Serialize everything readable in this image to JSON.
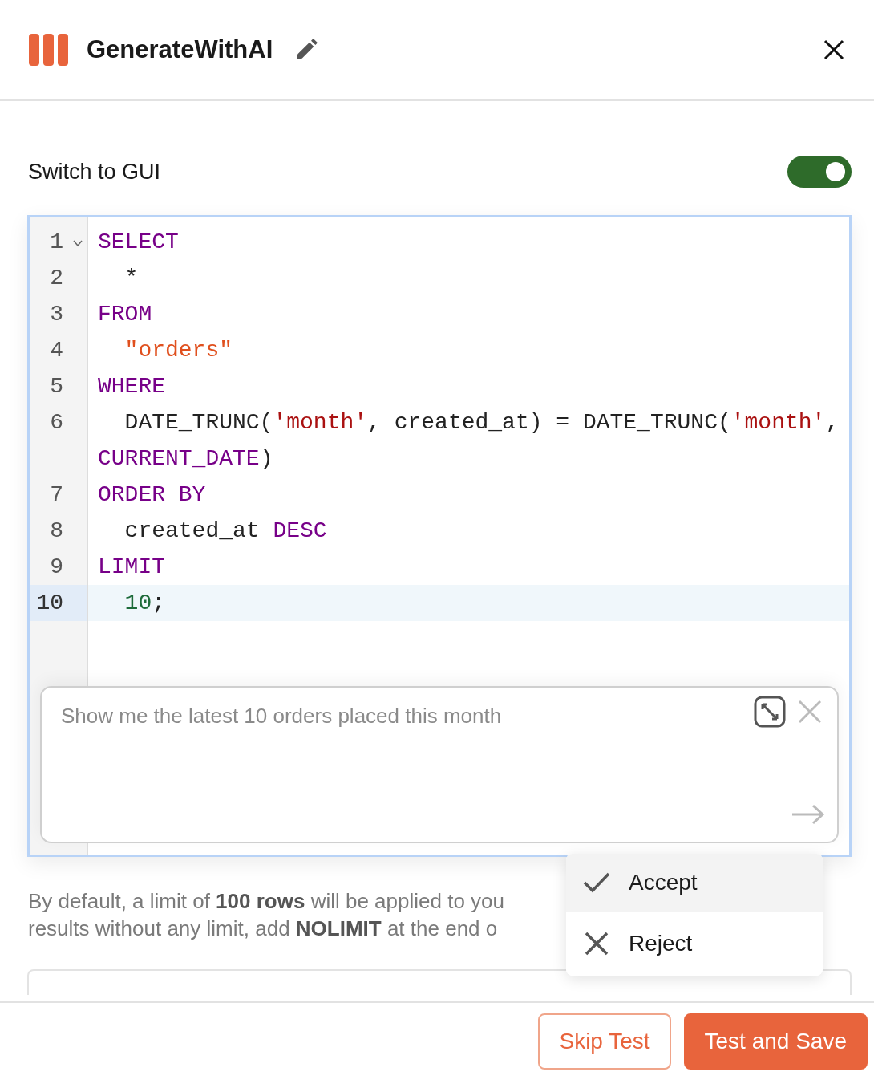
{
  "header": {
    "title": "GenerateWithAI"
  },
  "switch": {
    "label": "Switch to GUI",
    "on": true
  },
  "editor": {
    "lines": [
      {
        "number": "1",
        "foldable": true,
        "active": false,
        "indent": false,
        "segments": [
          {
            "kind": "keyword",
            "text": "SELECT"
          }
        ]
      },
      {
        "number": "2",
        "foldable": false,
        "active": false,
        "indent": true,
        "segments": [
          {
            "kind": "plain",
            "text": "*"
          }
        ]
      },
      {
        "number": "3",
        "foldable": false,
        "active": false,
        "indent": false,
        "segments": [
          {
            "kind": "keyword",
            "text": "FROM"
          }
        ]
      },
      {
        "number": "4",
        "foldable": false,
        "active": false,
        "indent": true,
        "segments": [
          {
            "kind": "string",
            "text": "\"orders\""
          }
        ]
      },
      {
        "number": "5",
        "foldable": false,
        "active": false,
        "indent": false,
        "segments": [
          {
            "kind": "keyword",
            "text": "WHERE"
          }
        ]
      },
      {
        "number": "6",
        "foldable": false,
        "active": false,
        "indent": true,
        "segments": [
          {
            "kind": "plain",
            "text": "DATE_TRUNC("
          },
          {
            "kind": "literal",
            "text": "'month'"
          },
          {
            "kind": "plain",
            "text": ", created_at) = DATE_TRUNC("
          },
          {
            "kind": "literal",
            "text": "'month'"
          },
          {
            "kind": "plain",
            "text": ", "
          },
          {
            "kind": "keyword",
            "text": "CURRENT_DATE"
          },
          {
            "kind": "plain",
            "text": ")"
          }
        ]
      },
      {
        "number": "7",
        "foldable": false,
        "active": false,
        "indent": false,
        "segments": [
          {
            "kind": "keyword",
            "text": "ORDER BY"
          }
        ]
      },
      {
        "number": "8",
        "foldable": false,
        "active": false,
        "indent": true,
        "segments": [
          {
            "kind": "plain",
            "text": "created_at "
          },
          {
            "kind": "keyword",
            "text": "DESC"
          }
        ]
      },
      {
        "number": "9",
        "foldable": false,
        "active": false,
        "indent": false,
        "segments": [
          {
            "kind": "keyword",
            "text": "LIMIT"
          }
        ]
      },
      {
        "number": "10",
        "foldable": false,
        "active": true,
        "indent": true,
        "segments": [
          {
            "kind": "number",
            "text": "10"
          },
          {
            "kind": "plain",
            "text": ";"
          }
        ]
      }
    ]
  },
  "prompt": {
    "placeholder": "Show me the latest 10 orders placed this month"
  },
  "note": {
    "lines": [
      "By default, a limit of **100 rows** will be applied to you",
      "results without any limit, add **NOLIMIT** at the end o"
    ]
  },
  "menu": {
    "items": [
      {
        "kind": "accept",
        "label": "Accept",
        "selected": true
      },
      {
        "kind": "reject",
        "label": "Reject",
        "selected": false
      }
    ]
  },
  "footer": {
    "buttons": [
      {
        "kind": "secondary",
        "label": "Skip Test"
      },
      {
        "kind": "primary",
        "label": "Test and Save"
      }
    ]
  }
}
